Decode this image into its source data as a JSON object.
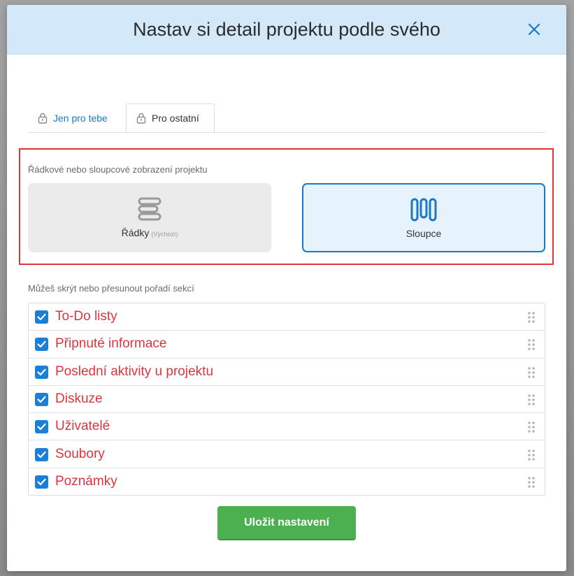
{
  "modal": {
    "title": "Nastav si detail projektu podle svého",
    "close_icon": "close-icon"
  },
  "tabs": [
    {
      "label": "Jen pro tebe",
      "icon": "lock-icon",
      "active": false
    },
    {
      "label": "Pro ostatní",
      "icon": "lock-icon",
      "active": true
    }
  ],
  "view_mode": {
    "label": "Řádkové nebo sloupcové zobrazení projektu",
    "options": [
      {
        "label": "Řádky",
        "sublabel": "(Výchozí)",
        "icon": "rows-icon",
        "selected": false
      },
      {
        "label": "Sloupce",
        "sublabel": "",
        "icon": "columns-icon",
        "selected": true
      }
    ]
  },
  "sections": {
    "label": "Můžeš skrýt nebo přesunout pořadí sekcí",
    "items": [
      {
        "label": "To-Do listy",
        "checked": true
      },
      {
        "label": "Připnuté informace",
        "checked": true
      },
      {
        "label": "Poslední aktivity u projektu",
        "checked": true
      },
      {
        "label": "Diskuze",
        "checked": true
      },
      {
        "label": "Uživatelé",
        "checked": true
      },
      {
        "label": "Soubory",
        "checked": true
      },
      {
        "label": "Poznámky",
        "checked": true
      }
    ]
  },
  "actions": {
    "save_label": "Uložit nastavení"
  },
  "colors": {
    "header_bg": "#d3e9f9",
    "accent": "#1b78c6",
    "section_label_red": "#d9363e",
    "save_green": "#4cb050",
    "highlight_border": "#e03535"
  }
}
